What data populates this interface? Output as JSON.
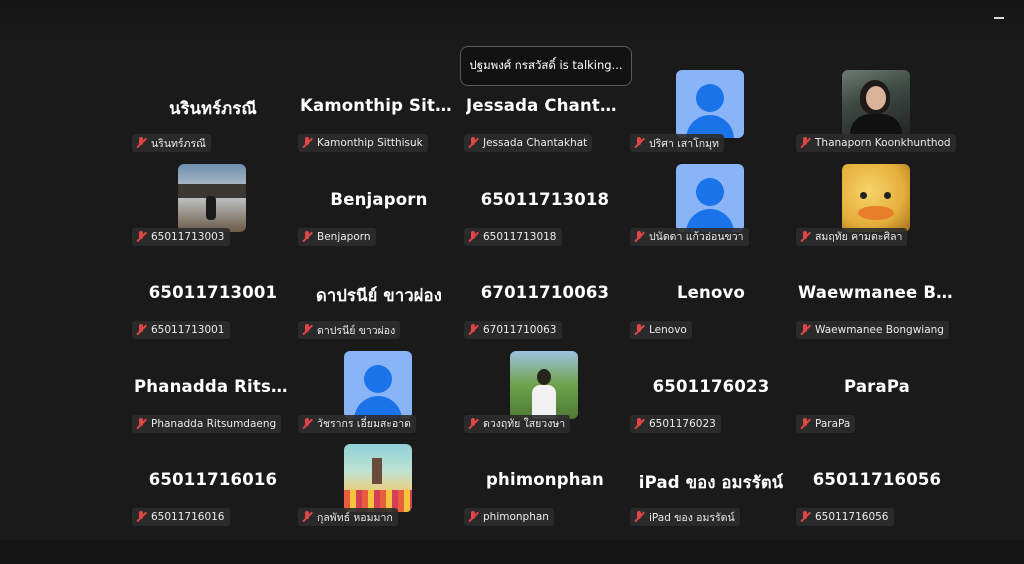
{
  "talking_banner": "ปฐมพงศ์ กรสวัสดิ์ is talking...",
  "participants": [
    {
      "display_name": "นรินทร์ภรณี",
      "label": "นรินทร์ภรณี",
      "avatar": "none"
    },
    {
      "display_name": "Kamonthip Sitthisuk",
      "label": "Kamonthip Sitthisuk",
      "avatar": "none"
    },
    {
      "display_name": "Jessada Chantakhat",
      "label": "Jessada Chantakhat",
      "avatar": "none"
    },
    {
      "display_name": "",
      "label": "ปริศา เสาโกมุท",
      "avatar": "generic"
    },
    {
      "display_name": "",
      "label": "Thanaporn Koonkhunthod",
      "avatar": "photo1"
    },
    {
      "display_name": "",
      "label": "65011713003",
      "avatar": "photo2"
    },
    {
      "display_name": "Benjaporn",
      "label": "Benjaporn",
      "avatar": "none"
    },
    {
      "display_name": "65011713018",
      "label": "65011713018",
      "avatar": "none"
    },
    {
      "display_name": "",
      "label": "ปนัดดา แก้วอ่อนขวา",
      "avatar": "generic"
    },
    {
      "display_name": "",
      "label": "สมฤทัย คามตะศิลา",
      "avatar": "duck"
    },
    {
      "display_name": "65011713001",
      "label": "65011713001",
      "avatar": "none"
    },
    {
      "display_name": "ดาปรนีย์ ขาวผ่อง",
      "label": "ดาปรนีย์ ขาวผ่อง",
      "avatar": "none"
    },
    {
      "display_name": "67011710063",
      "label": "67011710063",
      "avatar": "none"
    },
    {
      "display_name": "Lenovo",
      "label": "Lenovo",
      "avatar": "none"
    },
    {
      "display_name": "Waewmanee Bongwiang",
      "label": "Waewmanee Bongwiang",
      "avatar": "none"
    },
    {
      "display_name": "Phanadda Ritsumdaeng",
      "label": "Phanadda Ritsumdaeng",
      "avatar": "none"
    },
    {
      "display_name": "",
      "label": "วัชรากร เอี่ยมสะอาด",
      "avatar": "generic"
    },
    {
      "display_name": "",
      "label": "ดวงฤทัย ใสยวงษา",
      "avatar": "photo3"
    },
    {
      "display_name": "6501176023",
      "label": "6501176023",
      "avatar": "none"
    },
    {
      "display_name": "ParaPa",
      "label": "ParaPa",
      "avatar": "none"
    },
    {
      "display_name": "65011716016",
      "label": "65011716016",
      "avatar": "none"
    },
    {
      "display_name": "",
      "label": "กุลพัทธ์ หอมมาก",
      "avatar": "art"
    },
    {
      "display_name": "phimonphan",
      "label": "phimonphan",
      "avatar": "none"
    },
    {
      "display_name": "iPad ของ อมรรัตน์",
      "label": "iPad ของ อมรรัตน์",
      "avatar": "none"
    },
    {
      "display_name": "65011716056",
      "label": "65011716056",
      "avatar": "none"
    }
  ],
  "icons": {
    "minimize": "minimize-icon",
    "muted": "microphone-muted-icon"
  },
  "colors": {
    "background": "#1a1a1a",
    "muted_icon": "#e04646",
    "avatar_bg": "#8ab4f8",
    "avatar_fg": "#1a73e8"
  }
}
